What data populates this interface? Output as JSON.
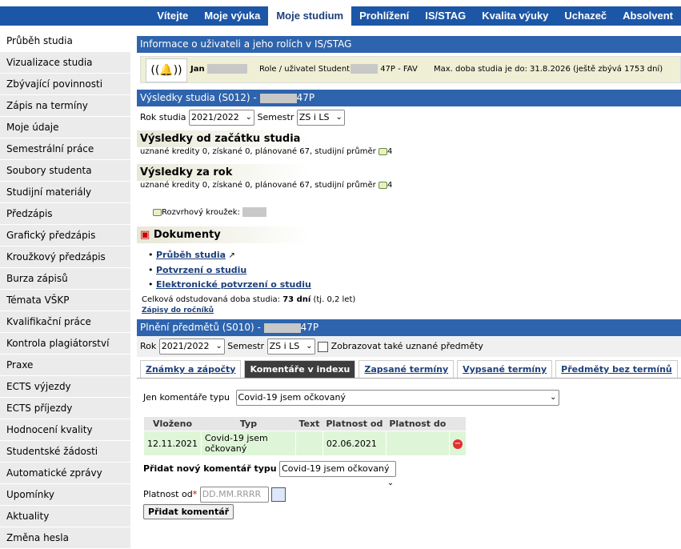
{
  "topnav": [
    "Vítejte",
    "Moje výuka",
    "Moje studium",
    "Prohlížení",
    "IS/STAG",
    "Kvalita výuky",
    "Uchazeč",
    "Absolvent"
  ],
  "sidebar": [
    "Průběh studia",
    "Vizualizace studia",
    "Zbývající povinnosti",
    "Zápis na termíny",
    "Moje údaje",
    "Semestrální práce",
    "Soubory studenta",
    "Studijní materiály",
    "Předzápis",
    "Grafický předzápis",
    "Kroužkový předzápis",
    "Burza zápisů",
    "Témata VŠKP",
    "Kvalifikační práce",
    "Kontrola plagiátorství",
    "Praxe",
    "ECTS výjezdy",
    "ECTS příjezdy",
    "Hodnocení kvality",
    "Studentské žádosti",
    "Automatické zprávy",
    "Upomínky",
    "Aktuality",
    "Změna hesla"
  ],
  "info": {
    "heading": "Informace o uživateli a jeho rolích v IS/STAG",
    "name_prefix": "Jan",
    "role_label": "Role / uživatel Student",
    "role_suffix": "47P - FAV",
    "max_label": "Max. doba studia je do:",
    "max_value": "31.8.2026 (ještě zbývá 1753 dní)"
  },
  "results": {
    "heading_prefix": "Výsledky studia (S012) -",
    "heading_suffix": "47P",
    "year_label": "Rok studia",
    "year_value": "2021/2022",
    "sem_label": "Semestr",
    "sem_value": "ZS i LS",
    "total_title": "Výsledky od začátku studia",
    "total_line": "uznané kredity 0, získané 0, plánované 67, studijní průměr",
    "total_count": "4",
    "year_title": "Výsledky za rok",
    "year_line": "uznané kredity 0, získané 0, plánované 67, studijní průměr",
    "year_count": "4",
    "circle_label": "Rozvrhový kroužek:",
    "docs_title": "Dokumenty",
    "docs": [
      "Průběh studia",
      "Potvrzení o studiu",
      "Elektronické potvrzení o studiu"
    ],
    "duration_label": "Celková odstudovaná doba studia:",
    "duration_value": "73 dní",
    "duration_suffix": "(tj. 0,2 let)",
    "enrol_link": "Zápisy do ročníků"
  },
  "subjects": {
    "heading_prefix": "Plnění předmětů (S010) -",
    "heading_suffix": "47P",
    "year_label": "Rok",
    "year_value": "2021/2022",
    "sem_label": "Semestr",
    "sem_value": "ZS i LS",
    "show_recognized_label": "Zobrazovat také uznané předměty",
    "tabs": [
      "Známky a zápočty",
      "Komentáře v indexu",
      "Zapsané termíny",
      "Vypsané termíny",
      "Předměty bez termínů"
    ],
    "filter_label": "Jen komentáře typu",
    "filter_value": "Covid-19 jsem očkovaný",
    "table_headers": [
      "Vloženo",
      "Typ",
      "Text",
      "Platnost od",
      "Platnost do"
    ],
    "table_row": [
      "12.11.2021",
      "Covid-19 jsem očkovaný",
      "",
      "02.06.2021",
      ""
    ],
    "add_label": "Přidat nový komentář typu",
    "add_value": "Covid-19 jsem očkovaný",
    "valid_from_label": "Platnost od",
    "valid_from_placeholder": "DD.MM.RRRR",
    "add_button": "Přidat komentář"
  }
}
